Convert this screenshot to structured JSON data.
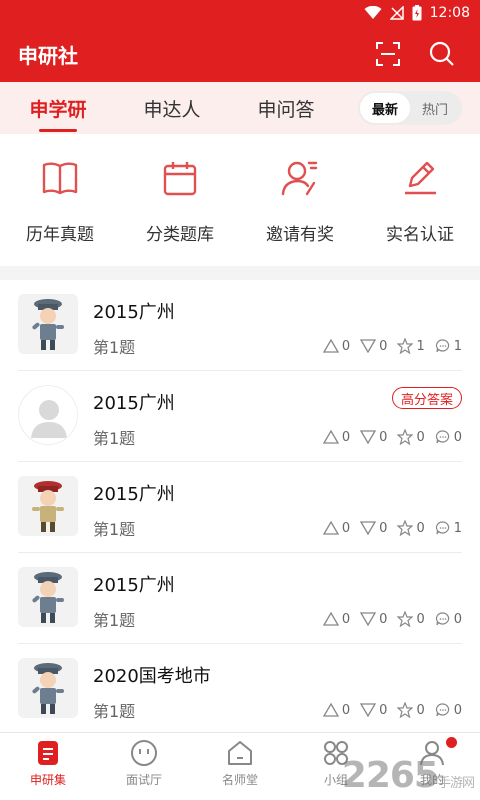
{
  "status": {
    "time": "12:08"
  },
  "appbar": {
    "title": "申研社",
    "scan_icon": "scan-icon",
    "search_icon": "search-icon"
  },
  "tabs": [
    {
      "label": "申学研",
      "active": true
    },
    {
      "label": "申达人",
      "active": false
    },
    {
      "label": "申问答",
      "active": false
    }
  ],
  "sort": {
    "latest": "最新",
    "hot": "热门",
    "selected": "最新"
  },
  "quick": [
    {
      "label": "历年真题",
      "icon": "book-icon"
    },
    {
      "label": "分类题库",
      "icon": "calendar-icon"
    },
    {
      "label": "邀请有奖",
      "icon": "invite-user-icon"
    },
    {
      "label": "实名认证",
      "icon": "pen-edit-icon"
    }
  ],
  "items": [
    {
      "title": "2015广州",
      "sub": "第1题",
      "badge": "",
      "up": "0",
      "down": "0",
      "fav": "1",
      "comment": "1",
      "avatar": "officer-avatar"
    },
    {
      "title": "2015广州",
      "sub": "第1题",
      "badge": "高分答案",
      "up": "0",
      "down": "0",
      "fav": "0",
      "comment": "0",
      "avatar": "default-avatar"
    },
    {
      "title": "2015广州",
      "sub": "第1题",
      "badge": "",
      "up": "0",
      "down": "0",
      "fav": "0",
      "comment": "1",
      "avatar": "officer-avatar-red"
    },
    {
      "title": "2015广州",
      "sub": "第1题",
      "badge": "",
      "up": "0",
      "down": "0",
      "fav": "0",
      "comment": "0",
      "avatar": "officer-avatar"
    },
    {
      "title": "2020国考地市",
      "sub": "第1题",
      "badge": "",
      "up": "0",
      "down": "0",
      "fav": "0",
      "comment": "0",
      "avatar": "officer-avatar"
    }
  ],
  "bottom_nav": [
    {
      "label": "申研集",
      "active": true
    },
    {
      "label": "面试厅",
      "active": false
    },
    {
      "label": "名师堂",
      "active": false
    },
    {
      "label": "小组",
      "active": false
    },
    {
      "label": "我的",
      "active": false
    }
  ],
  "watermark": {
    "brand": "2265",
    "site": "手游网"
  },
  "colors": {
    "accent": "#E02020",
    "tab_bg": "#FDEEEE"
  }
}
